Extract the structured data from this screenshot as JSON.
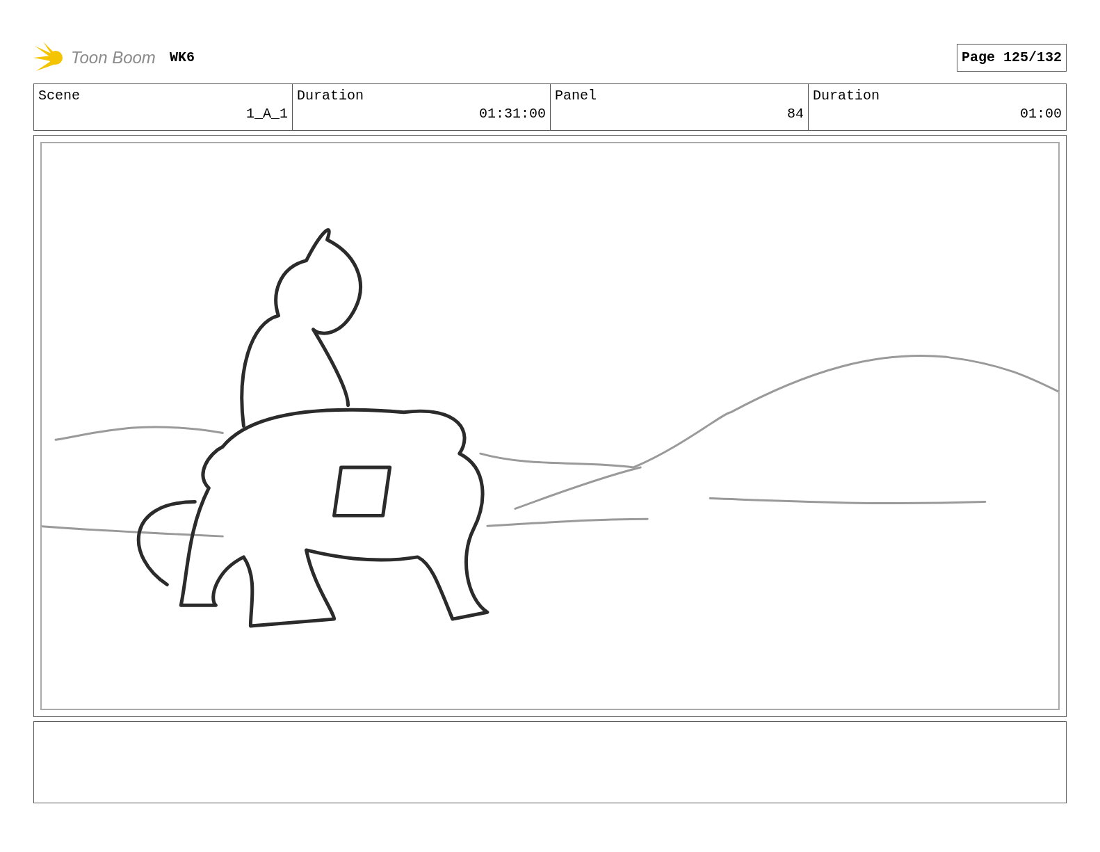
{
  "header": {
    "logo_text": "Toon Boom",
    "title": "WK6",
    "page": "Page 125/132"
  },
  "info_table": {
    "labels": [
      "Scene",
      "Duration",
      "Panel",
      "Duration"
    ],
    "values": [
      "1_A_1",
      "01:31:00",
      "84",
      "01:00"
    ]
  }
}
